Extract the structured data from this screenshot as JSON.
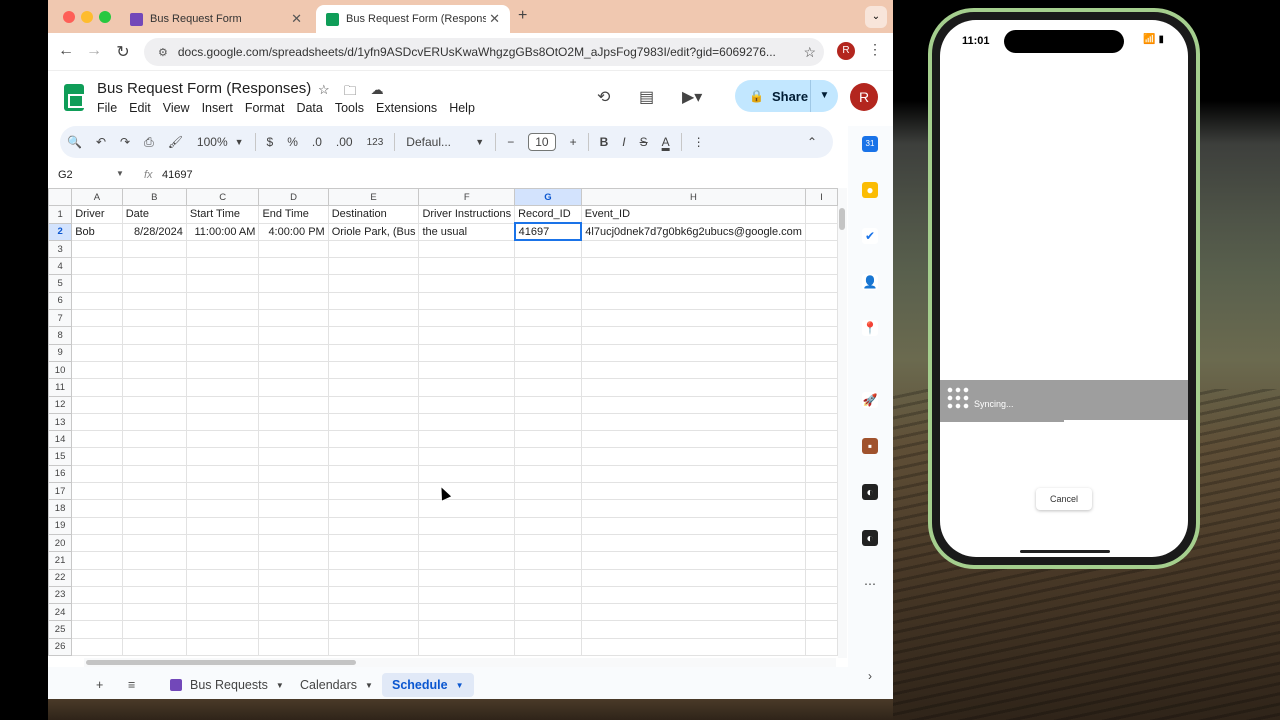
{
  "browser": {
    "tabs": [
      {
        "title": "Bus Request Form",
        "color": "#7248b9",
        "active": false
      },
      {
        "title": "Bus Request Form (Responses)",
        "color": "#0f9d58",
        "active": true
      }
    ],
    "url": "docs.google.com/spreadsheets/d/1yfn9ASDcvERUsKwaWhgzgGBs8OtO2M_aJpsFog7983I/edit?gid=6069276...",
    "profile_initial": "R"
  },
  "sheets": {
    "doc_title": "Bus Request Form (Responses)",
    "menus": [
      "File",
      "Edit",
      "View",
      "Insert",
      "Format",
      "Data",
      "Tools",
      "Extensions",
      "Help"
    ],
    "share_label": "Share",
    "avatar_initial": "R",
    "toolbar": {
      "zoom": "100%",
      "currency": "$",
      "percent": "%",
      "dec_decrease": ".0",
      "dec_increase": ".00",
      "number_format": "123",
      "font": "Defaul...",
      "font_size": "10",
      "minus": "−",
      "plus": "+",
      "bold": "B",
      "italic": "I",
      "strike": "S",
      "text_color": "A"
    },
    "formula_bar": {
      "cell_ref": "G2",
      "fx": "fx",
      "value": "41697"
    },
    "columns": [
      "A",
      "B",
      "C",
      "D",
      "E",
      "F",
      "G",
      "H",
      "I"
    ],
    "selected_column": "G",
    "header_row": [
      "Driver",
      "Date",
      "Start Time",
      "End Time",
      "Destination",
      "Driver Instructions",
      "Record_ID",
      "Event_ID",
      ""
    ],
    "data_row": [
      "Bob",
      "8/28/2024",
      "11:00:00 AM",
      "4:00:00 PM",
      "Oriole Park, (Bus",
      "the usual",
      "41697",
      "4l7ucj0dnek7d7g0bk6g2ubucs@google.com",
      ""
    ],
    "row_count": 26,
    "sheet_tabs": [
      {
        "name": "Bus Requests",
        "active": false
      },
      {
        "name": "Calendars",
        "active": false
      },
      {
        "name": "Schedule",
        "active": true
      }
    ]
  },
  "phone": {
    "time": "11:01",
    "sync_text": "Syncing...",
    "cancel_label": "Cancel"
  }
}
